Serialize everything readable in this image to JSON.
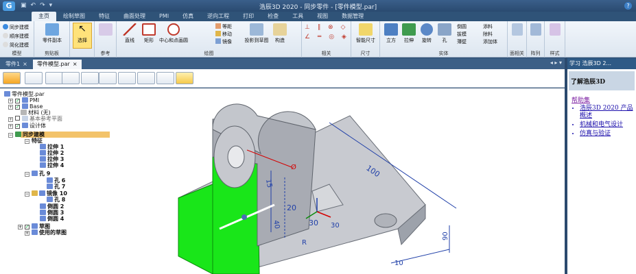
{
  "titlebar": {
    "logo": "G",
    "title": "浩辰3D 2020 - 同步零件 - [零件模型.par]",
    "qat": [
      "▣",
      "↶",
      "↷",
      "▾"
    ],
    "help": "?"
  },
  "menu_tabs": [
    "主页",
    "绘制草图",
    "特征",
    "曲面处理",
    "PMI",
    "仿真",
    "逆向工程",
    "打印",
    "检查",
    "工具",
    "视图",
    "数据管理"
  ],
  "ribbon": {
    "mode": {
      "items": [
        "同步建模",
        "顺序建模",
        "简化建模"
      ],
      "label": "模型"
    },
    "clipboard": {
      "paste": "零件副本",
      "label": "剪贴板"
    },
    "select": {
      "label": "选择"
    },
    "reference": {
      "label": "参考"
    },
    "draw": {
      "items": [
        "直线",
        "矩形",
        "中心和点画圆"
      ],
      "small": [
        "等距",
        "移动",
        "镜像"
      ],
      "project": "投影到草图",
      "construct": "构造",
      "label": "绘图"
    },
    "relations": {
      "label": "相关"
    },
    "dimension": {
      "smart": "智能尺寸",
      "label": "尺寸"
    },
    "solids": {
      "items": [
        "立方",
        "拉伸",
        "旋转",
        "孔"
      ],
      "small_a": [
        "倒圆",
        "拔模",
        "薄壁"
      ],
      "small_b": [
        "添料",
        "除料",
        "添加体"
      ],
      "label": "实体"
    },
    "face_rel": {
      "label": "面相关"
    },
    "pattern": {
      "label": "阵列"
    },
    "style": {
      "label": "样式"
    }
  },
  "doc_tabs": [
    {
      "label": "零件1",
      "close": "×"
    },
    {
      "label": "零件模型.par",
      "close": "×"
    }
  ],
  "doc_nav": "◂ ▸ ▾",
  "tree": [
    {
      "label": "零件模型.par"
    },
    {
      "label": "PMI"
    },
    {
      "label": "Base"
    },
    {
      "label": "材料 (无)"
    },
    {
      "label": "基本参考平面"
    },
    {
      "label": "设计体"
    },
    {
      "label": "同步建模"
    },
    {
      "label": "特征"
    },
    {
      "label": "拉伸 1"
    },
    {
      "label": "拉伸 2"
    },
    {
      "label": "拉伸 3"
    },
    {
      "label": "拉伸 4"
    },
    {
      "label": "孔 9"
    },
    {
      "label": "孔 6"
    },
    {
      "label": "孔 7"
    },
    {
      "label": "镜像 10"
    },
    {
      "label": "孔 8"
    },
    {
      "label": "倒圆 2"
    },
    {
      "label": "倒圆 3"
    },
    {
      "label": "倒圆 4"
    },
    {
      "label": "草图"
    },
    {
      "label": "使用的草图"
    }
  ],
  "dimensions": [
    "100",
    "15",
    "20",
    "40",
    "30",
    "30",
    "90",
    "10",
    "Ø",
    "R"
  ],
  "helppanel": {
    "title": "学习 浩辰3D 2...",
    "banner": "了解浩辰3D",
    "heading": "帮助集",
    "links": [
      "浩辰3D 2020 产品概述",
      "机械和电气设计",
      "仿真与验证"
    ]
  },
  "colors": {
    "accent": "#2e5a86",
    "select_bg": "#ffe27a",
    "highlight_face": "#19e619",
    "dimension": "#1f3fa8",
    "dim_red": "#d40000"
  }
}
